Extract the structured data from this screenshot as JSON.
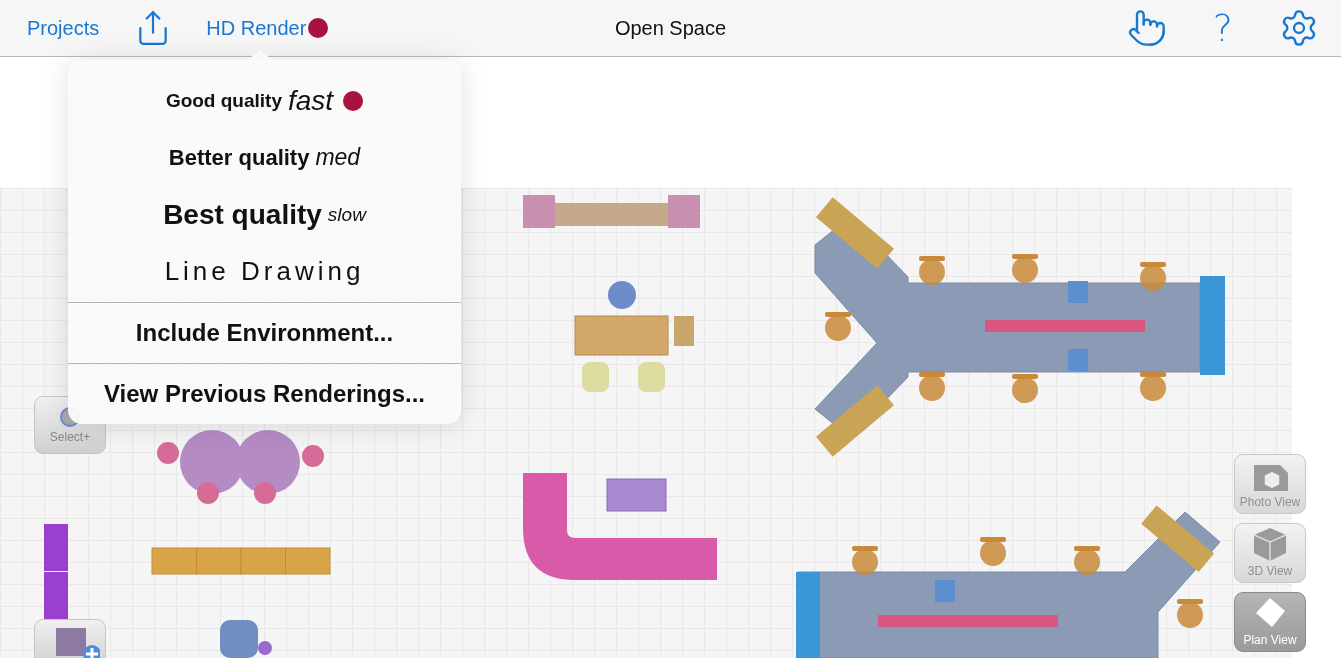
{
  "toolbar": {
    "back_button": "Projects",
    "render_button": {
      "label": "HD Render",
      "marked": true
    },
    "title": "Open Space",
    "help_button": "?"
  },
  "render_menu": {
    "quality_options": [
      {
        "kind": "quality",
        "label": "Good quality",
        "speed": "fast",
        "selected": true
      },
      {
        "kind": "quality",
        "label": "Better quality",
        "speed": "med",
        "selected": false
      },
      {
        "kind": "quality",
        "label": "Best quality",
        "speed": "slow",
        "selected": false
      },
      {
        "kind": "line",
        "label": "Line Drawing",
        "selected": false
      }
    ],
    "actions": [
      "Include Environment...",
      "View Previous Renderings..."
    ]
  },
  "tools": [
    {
      "label": "Select+"
    }
  ],
  "view_buttons": [
    {
      "label": "Photo View",
      "kind": "photo",
      "selected": false
    },
    {
      "label": "3D View",
      "kind": "cube",
      "selected": false
    },
    {
      "label": "Plan View",
      "kind": "plan",
      "selected": true
    }
  ]
}
